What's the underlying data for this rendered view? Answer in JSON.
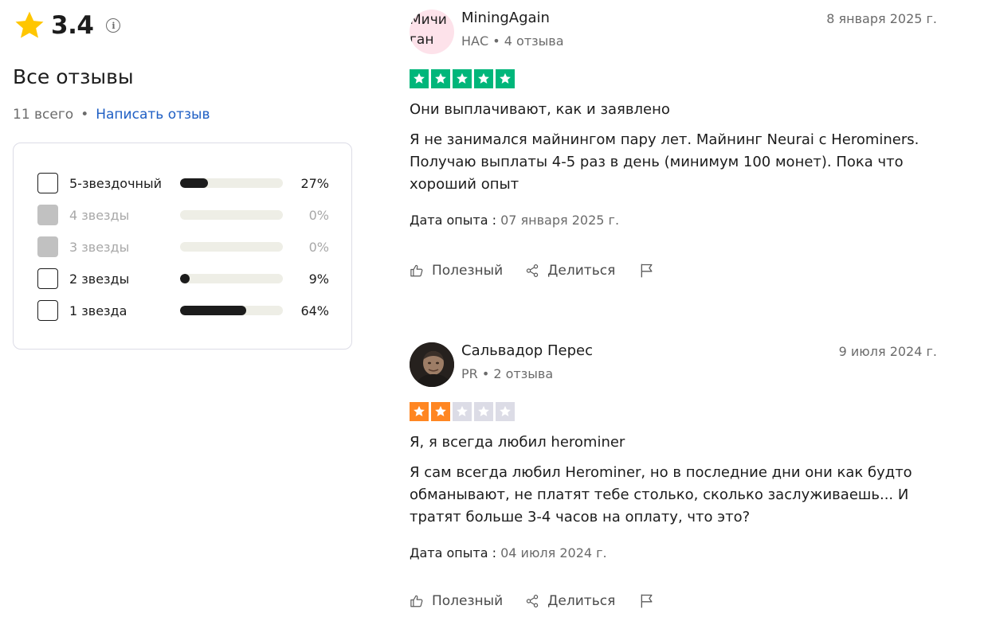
{
  "summary": {
    "score": "3.4",
    "heading": "Все отзывы",
    "total": "11 всего",
    "separator": "•",
    "write_link": "Написать отзыв",
    "filters": [
      {
        "label": "5-звездочный",
        "percent_text": "27%",
        "percent": 27,
        "enabled": true
      },
      {
        "label": "4 звезды",
        "percent_text": "0%",
        "percent": 0,
        "enabled": false
      },
      {
        "label": "3 звезды",
        "percent_text": "0%",
        "percent": 0,
        "enabled": false
      },
      {
        "label": "2 звезды",
        "percent_text": "9%",
        "percent": 9,
        "enabled": true
      },
      {
        "label": "1 звезда",
        "percent_text": "64%",
        "percent": 64,
        "enabled": true
      }
    ]
  },
  "reviews": [
    {
      "avatar_lines": [
        "Мичи",
        "ган"
      ],
      "name": "MiningAgain",
      "meta": "НАС • 4 отзыва",
      "date": "8 января 2025 г.",
      "rating": 5,
      "title": "Они выплачивают, как и заявлено",
      "body": "Я не занимался майнингом пару лет. Майнинг Neurai с Herominers. Получаю выплаты 4-5 раз в день (минимум 100 монет). Пока что хороший опыт",
      "experience_label": "Дата опыта :",
      "experience_date": "07 января 2025 г.",
      "useful_label": "Полезный",
      "share_label": "Делиться"
    },
    {
      "name": "Сальвадор Перес",
      "meta": "PR • 2 отзыва",
      "date": "9 июля 2024 г.",
      "rating": 2,
      "title": "Я, я всегда любил herominer",
      "body": "Я сам всегда любил Herominer, но в последние дни они как будто обманывают, не платят тебе столько, сколько заслуживаешь... И тратят больше 3-4 часов на оплату, что это?",
      "experience_label": "Дата опыта :",
      "experience_date": "04 июля 2024 г.",
      "useful_label": "Полезный",
      "share_label": "Делиться"
    }
  ],
  "colors": {
    "star_summary": "#ffc600",
    "star_five": "#00b67a",
    "star_two": "#ff8622",
    "star_empty": "#dcdce6",
    "link": "#1f5fc4",
    "avatar_initials_bg": "#fde2ea"
  },
  "icons": [
    "star-icon",
    "info-icon",
    "thumbs-up-icon",
    "share-icon",
    "flag-icon"
  ]
}
